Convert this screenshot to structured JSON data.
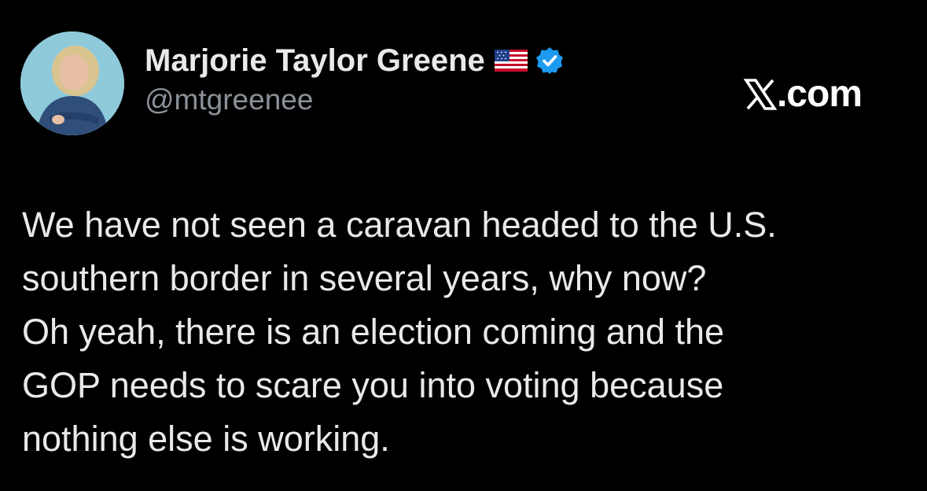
{
  "site": {
    "label": ".com",
    "logo": "x-logo-icon"
  },
  "author": {
    "display_name": "Marjorie Taylor Greene",
    "handle": "@mtgreenee",
    "badges": [
      "us-flag-icon",
      "verified-icon"
    ],
    "avatar": "avatar"
  },
  "tweet": {
    "lines": [
      "We have not seen a caravan headed to the U.S.",
      "southern border in several years, why now?",
      "Oh yeah, there is an election coming and the",
      "GOP needs to scare you into voting because",
      "nothing else is working."
    ]
  },
  "colors": {
    "background": "#000000",
    "text_primary": "#e7e9ea",
    "text_secondary": "#8b9198",
    "verified_blue": "#1d9bf0"
  }
}
